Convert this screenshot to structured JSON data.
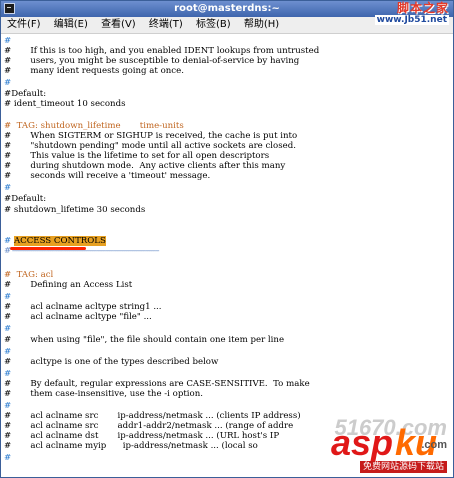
{
  "window": {
    "title": "root@masterdns:~"
  },
  "menu": {
    "items": [
      {
        "label": "文件(F)"
      },
      {
        "label": "编辑(E)"
      },
      {
        "label": "查看(V)"
      },
      {
        "label": "终端(T)"
      },
      {
        "label": "标签(B)"
      },
      {
        "label": "帮助(H)"
      }
    ]
  },
  "logo": {
    "main": "脚本之家",
    "url": "www.Jb51.net"
  },
  "terminal": {
    "lines": {
      "l1": "#",
      "l2": "#       If this is too high, and you enabled IDENT lookups from untrusted",
      "l3": "#       users, you might be susceptible to denial-of-service by having",
      "l4": "#       many ident requests going at once.",
      "l5": "#",
      "l6": "#Default:",
      "l7": "# ident_timeout 10 seconds",
      "l8_tag": "#  TAG: shutdown_lifetime       time-units",
      "l9": "#       When SIGTERM or SIGHUP is received, the cache is put into",
      "l10": "#       \"shutdown pending\" mode until all active sockets are closed.",
      "l11": "#       This value is the lifetime to set for all open descriptors",
      "l12": "#       during shutdown mode.  Any active clients after this many",
      "l13": "#       seconds will receive a 'timeout' message.",
      "l14": "#",
      "l15": "#Default:",
      "l16": "# shutdown_lifetime 30 seconds",
      "l17_hash": "# ",
      "l17_access": "ACCESS CONTROLS",
      "l18": "# -----------------------------------------------------------------------------",
      "l19_tag": "#  TAG: acl",
      "l20": "#       Defining an Access List",
      "l21": "#",
      "l22": "#       acl aclname acltype string1 ...",
      "l23": "#       acl aclname acltype \"file\" ...",
      "l24": "#",
      "l25": "#       when using \"file\", the file should contain one item per line",
      "l26": "#",
      "l27": "#       acltype is one of the types described below",
      "l28": "#",
      "l29": "#       By default, regular expressions are CASE-SENSITIVE.  To make",
      "l30": "#       them case-insensitive, use the -i option.",
      "l31": "#",
      "l32": "#       acl aclname src       ip-address/netmask ... (clients IP address)",
      "l33": "#       acl aclname src       addr1-addr2/netmask ... (range of addre",
      "l34": "#       acl aclname dst       ip-address/netmask ... (URL host's IP",
      "l35": "#       acl aclname myip      ip-address/netmask ... (local so",
      "l36": "#"
    }
  },
  "watermark": {
    "number": "51670.com",
    "brand_a": "asp",
    "brand_b": "ku",
    "domain": ".com",
    "tagline": "免费网站源码下载站"
  },
  "colors": {
    "comment_blue": "#2a7bd0",
    "highlight": "#e7a021",
    "annotation_red": "#ff2200"
  }
}
